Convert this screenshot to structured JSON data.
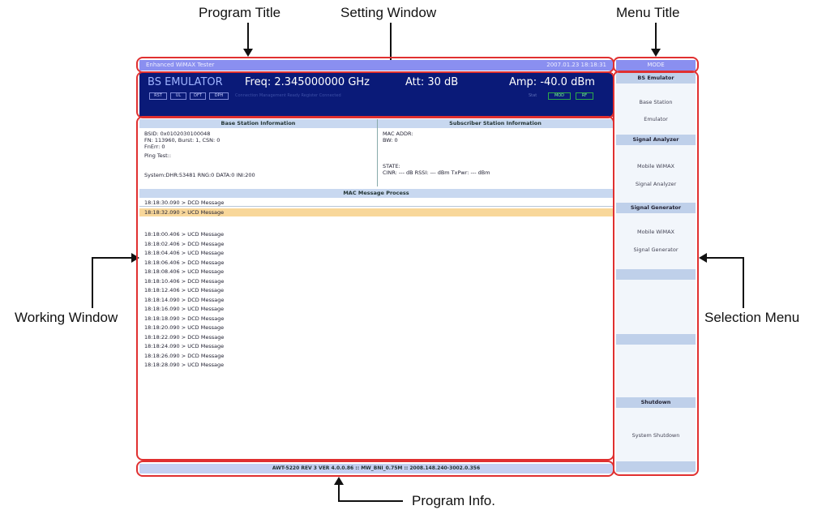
{
  "annotations": {
    "program_title": "Program Title",
    "setting_window": "Setting Window",
    "menu_title": "Menu Title",
    "working_window": "Working Window",
    "selection_menu": "Selection Menu",
    "program_info": "Program Info."
  },
  "titlebar": {
    "title": "Enhanced WiMAX Tester",
    "datetime": "2007.01.23 18:18:31"
  },
  "settings": {
    "mode": "BS EMULATOR",
    "freq": "Freq: 2.345000000 GHz",
    "att": "Att: 30 dB",
    "amp": "Amp: -40.0 dBm",
    "buttons": [
      "RST",
      "UL",
      "DFT",
      "DPH"
    ],
    "faint_text": "Connection Management Ready Register Connected",
    "status_label": "Stat",
    "status_buttons": [
      "MOD",
      "RF"
    ]
  },
  "base_station": {
    "header": "Base Station Information",
    "lines": [
      "BSID: 0x0102030100048",
      "FN:   113960, Burst: 1, CSN: 0",
      "FnErr: 0",
      "",
      "Ping Test::",
      "",
      "",
      "System:DHR:53481  RNG:0  DATA:0  INI:200"
    ]
  },
  "subscriber_station": {
    "header": "Subscriber Station Information",
    "lines": [
      "MAC ADDR:",
      "BW: 0",
      "",
      "",
      "",
      "STATE:",
      "CINR: --- dB   RSSI: --- dBm   TxPwr: --- dBm"
    ]
  },
  "mac_process": {
    "header": "MAC Message Process",
    "messages": [
      {
        "text": "18:18:30.090 > DCD Message",
        "style": "sep"
      },
      {
        "text": "18:18:32.090 > UCD Message",
        "style": "hl"
      },
      {
        "text": "",
        "style": ""
      },
      {
        "text": "18:18:00.406 > UCD Message",
        "style": ""
      },
      {
        "text": "18:18:02.406 > DCD Message",
        "style": ""
      },
      {
        "text": "18:18:04.406 > UCD Message",
        "style": ""
      },
      {
        "text": "18:18:06.406 > DCD Message",
        "style": ""
      },
      {
        "text": "18:18:08.406 > UCD Message",
        "style": ""
      },
      {
        "text": "18:18:10.406 > DCD Message",
        "style": ""
      },
      {
        "text": "18:18:12.406 > UCD Message",
        "style": ""
      },
      {
        "text": "18:18:14.090 > DCD Message",
        "style": ""
      },
      {
        "text": "18:18:16.090 > UCD Message",
        "style": ""
      },
      {
        "text": "18:18:18.090 > DCD Message",
        "style": ""
      },
      {
        "text": "18:18:20.090 > UCD Message",
        "style": ""
      },
      {
        "text": "18:18:22.090 > DCD Message",
        "style": ""
      },
      {
        "text": "18:18:24.090 > UCD Message",
        "style": ""
      },
      {
        "text": "18:18:26.090 > DCD Message",
        "style": ""
      },
      {
        "text": "18:18:28.090 > UCD Message",
        "style": ""
      }
    ]
  },
  "program_info": "AWT-5220 REV 3 VER 4.0.0.86 :: MW_BNI_0.75M :: 2008.148.240-3002.0.356",
  "menu": {
    "title": "MODE",
    "sections": [
      {
        "header": "BS Emulator",
        "items": [
          "Base Station",
          "Emulator"
        ]
      },
      {
        "header": "Signal Analyzer",
        "items": [
          "Mobile WiMAX",
          "Signal Analyzer"
        ]
      },
      {
        "header": "Signal Generator",
        "items": [
          "Mobile WiMAX",
          "Signal Generator"
        ]
      },
      {
        "header": "Shutdown",
        "items": [
          "System Shutdown"
        ]
      }
    ]
  },
  "colors": {
    "title_bar": "#8a8ff0",
    "setting_bg": "#0a1a78",
    "highlight_row": "#f8d79a",
    "annotation_box": "#e03030"
  }
}
